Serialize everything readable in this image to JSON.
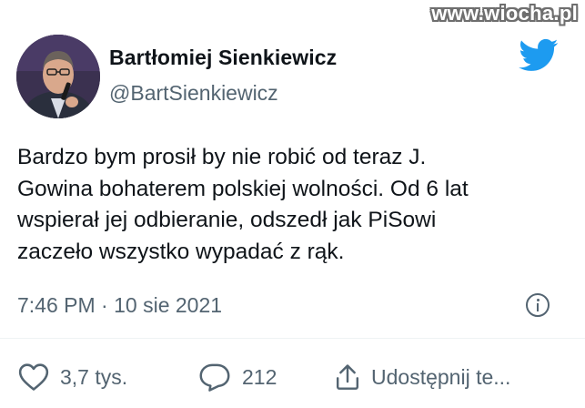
{
  "watermark": "www.wiocha.pl",
  "author": {
    "name": "Bartłomiej Sienkiewicz",
    "handle": "@BartSienkiewicz"
  },
  "tweet": {
    "lines": [
      "Bardzo bym prosił by nie robić od teraz J.",
      "Gowina bohaterem polskiej wolności. Od 6 lat",
      "wspierał jej odbieranie, odszedł jak PiSowi",
      "zaczeło wszystko wypadać z rąk."
    ]
  },
  "meta": {
    "time": "7:46 PM",
    "separator": "·",
    "date": "10 sie 2021"
  },
  "actions": {
    "likes": "3,7 tys.",
    "replies": "212",
    "share": "Udostępnij te..."
  },
  "icons": {
    "twitter": "twitter-bird-icon",
    "info": "info-icon",
    "like": "heart-icon",
    "reply": "reply-bubble-icon",
    "share": "share-icon"
  },
  "colors": {
    "text": "#0f1419",
    "secondary": "#536471",
    "brand": "#1d9bf0"
  }
}
